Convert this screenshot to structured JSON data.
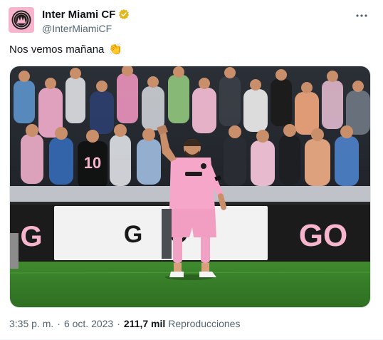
{
  "account": {
    "display_name": "Inter Miami CF",
    "handle": "@InterMiamiCF",
    "verified": true,
    "verified_color": "#e2b719",
    "avatar_background": "#f7b5cd"
  },
  "tweet": {
    "text": "Nos vemos mañana",
    "emoji": "👏",
    "media": {
      "description_icon": "photo",
      "jersey_number": "10",
      "board_text_left": "G O",
      "board_text_right": "GO"
    }
  },
  "meta": {
    "time": "3:35 p. m.",
    "separator": "·",
    "date": "6 oct. 2023",
    "views_count": "211,7 mil",
    "views_label": "Reproducciones"
  },
  "menu": {
    "icon": "more-horizontal-icon"
  },
  "colors": {
    "text_primary": "#0f1419",
    "text_secondary": "#536471",
    "pink": "#f7b5cd",
    "grass": "#3f8a2e"
  }
}
